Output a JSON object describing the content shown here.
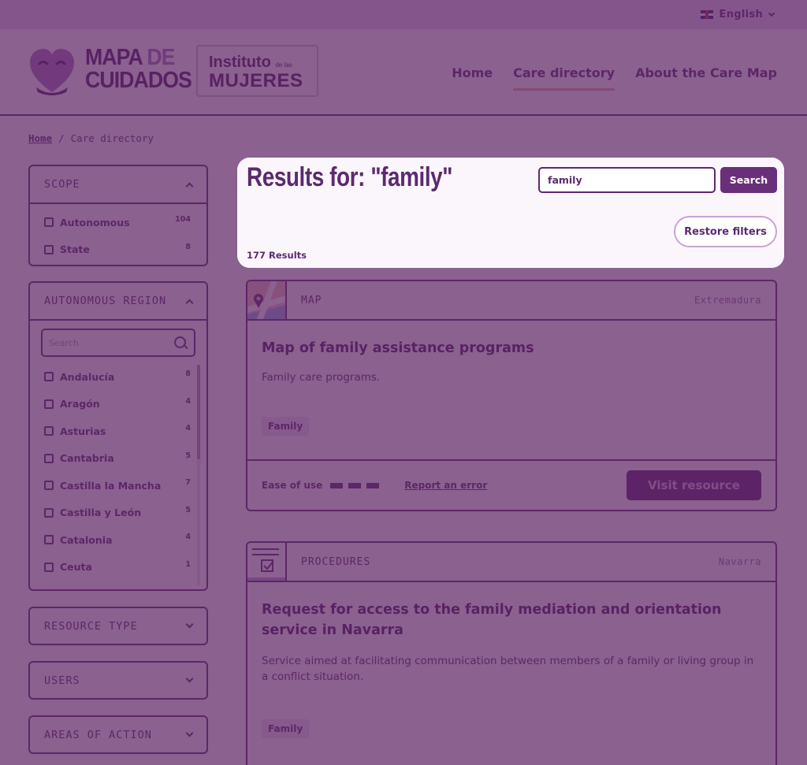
{
  "topbar": {
    "language": "English"
  },
  "header": {
    "logo_line1": "MAPA",
    "logo_line1_accent": "DE",
    "logo_line2": "CUIDADOS",
    "institute_line1": "Instituto",
    "institute_small": "de las",
    "institute_line2": "MUJERES",
    "nav": [
      {
        "label": "Home"
      },
      {
        "label": "Care directory",
        "active": true
      },
      {
        "label": "About the Care Map"
      }
    ]
  },
  "breadcrumb": {
    "home": "Home",
    "separator": "/",
    "current": "Care directory"
  },
  "sidebar": {
    "scope": {
      "title": "SCOPE",
      "options": [
        {
          "label": "Autonomous",
          "count": "104"
        },
        {
          "label": "State",
          "count": "8"
        }
      ]
    },
    "region": {
      "title": "AUTONOMOUS REGION",
      "search_placeholder": "Search",
      "options": [
        {
          "label": "Andalucía",
          "count": "8"
        },
        {
          "label": "Aragón",
          "count": "4"
        },
        {
          "label": "Asturias",
          "count": "4"
        },
        {
          "label": "Cantabria",
          "count": "5"
        },
        {
          "label": "Castilla la Mancha",
          "count": "7"
        },
        {
          "label": "Castilla y León",
          "count": "5"
        },
        {
          "label": "Catalonia",
          "count": "4"
        },
        {
          "label": "Ceuta",
          "count": "1"
        }
      ]
    },
    "resource_type": {
      "title": "RESOURCE TYPE"
    },
    "users": {
      "title": "USERS"
    },
    "areas": {
      "title": "AREAS OF ACTION"
    }
  },
  "results": {
    "title": "Results for: \"family\"",
    "search_value": "family",
    "search_button": "Search",
    "restore_button": "Restore filters",
    "count_text": "177 Results"
  },
  "cards": [
    {
      "type": "MAP",
      "region": "Extremadura",
      "title": "Map of family assistance programs",
      "description": "Family care programs.",
      "tag": "Family",
      "ease_label": "Ease of use",
      "report_label": "Report an error",
      "visit_label": "Visit resource"
    },
    {
      "type": "PROCEDURES",
      "region": "Navarra",
      "title": "Request for access to the family mediation and orientation service in Navarra",
      "description": "Service aimed at facilitating communication between members of a family or living group in a conflict situation.",
      "tag": "Family"
    }
  ],
  "colors": {
    "primary": "#5b2a6e",
    "button": "#6a2f7a",
    "overlay": "#581e60",
    "highlight_bg": "#fbf6fc",
    "accent_underline": "#e6b9a8"
  },
  "icons": {
    "language": "uk-flag-icon",
    "heart_logo": "heart-logo-icon",
    "search": "search-icon",
    "map_thumb": "map-pin-icon",
    "procedures_thumb": "checklist-icon"
  }
}
